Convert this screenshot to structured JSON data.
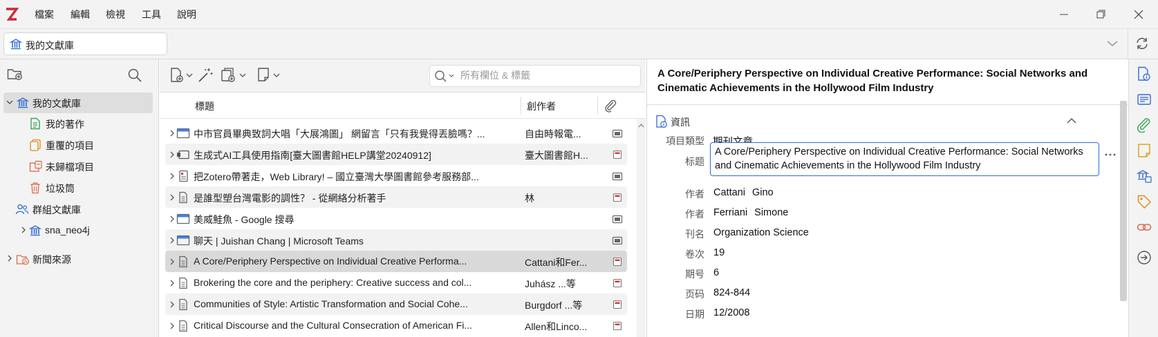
{
  "menu": [
    "檔案",
    "編輯",
    "檢視",
    "工具",
    "說明"
  ],
  "tab": {
    "label": "我的文獻庫"
  },
  "collections": {
    "my_library": "我的文獻庫",
    "my_publications": "我的著作",
    "duplicates": "重覆的項目",
    "unfiled": "未歸檔項目",
    "trash": "垃圾筒",
    "group_libraries": "群組文獻庫",
    "group_sna": "sna_neo4j",
    "feeds": "新聞來源"
  },
  "search": {
    "placeholder": "所有欄位 & 標籤"
  },
  "columns": {
    "title": "標題",
    "creator": "創作者"
  },
  "items": [
    {
      "title": "中市官員畢典致詞大唱「大展鴻圖」 網留言「只有我覺得丟臉嗎？...",
      "creator": "自由時報電..."
    },
    {
      "title": "生成式AI工具使用指南[臺大圖書館HELP講堂20240912]",
      "creator": "臺大圖書館H..."
    },
    {
      "title": "把Zotero帶著走，Web Library! – 國立臺灣大學圖書館參考服務部...",
      "creator": ""
    },
    {
      "title": "是誰型塑台灣電影的調性？ - 從網絡分析著手",
      "creator": "林"
    },
    {
      "title": "美威鮭魚 - Google 搜尋",
      "creator": ""
    },
    {
      "title": "聊天 | Juishan Chang | Microsoft Teams",
      "creator": ""
    },
    {
      "title": "A Core/Periphery Perspective on Individual Creative Performa...",
      "creator": "Cattani和Fer..."
    },
    {
      "title": "Brokering the core and the periphery: Creative success and col...",
      "creator": "Juhász ...等"
    },
    {
      "title": "Communities of Style: Artistic Transformation and Social Cohe...",
      "creator": "Burgdorf ...等"
    },
    {
      "title": "Critical Discourse and the Cultural Consecration of American Fi...",
      "creator": "Allen和Linco..."
    }
  ],
  "item_pane": {
    "title": "A Core/Periphery Perspective on Individual Creative Performance: Social Networks and Cinematic Achievements in the Hollywood Film Industry",
    "section_info": "資訊",
    "fields": {
      "item_type_label": "項目類型",
      "item_type": "期刊文章",
      "title_label": "标题",
      "title_value": "A Core/Periphery Perspective on Individual Creative Performance: Social Networks and Cinematic Achievements in the Hollywood Film Industry",
      "author_label": "作者",
      "author1_last": "Cattani",
      "author1_first": "Gino",
      "author2_last": "Ferriani",
      "author2_first": "Simone",
      "publication_label": "刊名",
      "publication": "Organization Science",
      "volume_label": "卷次",
      "volume": "19",
      "issue_label": "期号",
      "issue": "6",
      "pages_label": "页码",
      "pages": "824-844",
      "date_label": "日期",
      "date": "12/2008"
    }
  },
  "colors": {
    "accent": "#2f6ad1",
    "logo_red": "#cc2936",
    "green": "#3aa65a",
    "orange": "#e08a1e"
  }
}
